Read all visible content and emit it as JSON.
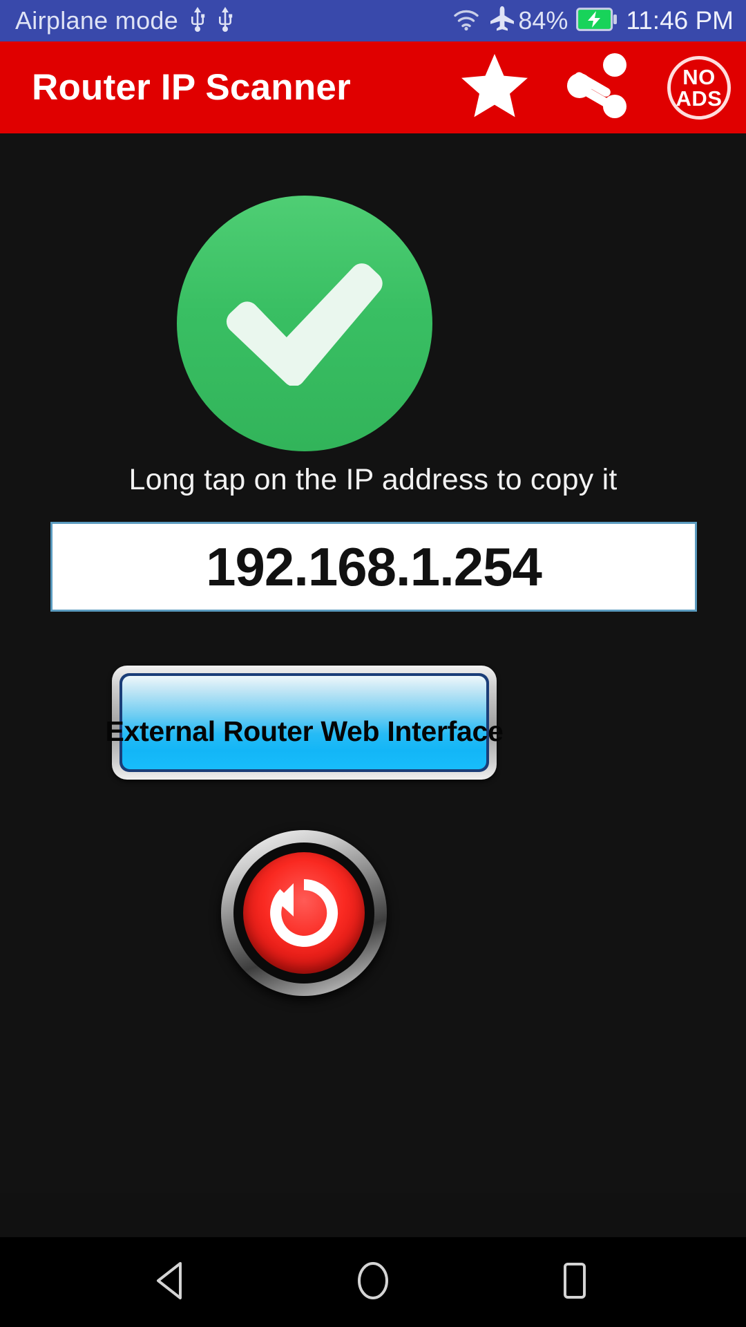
{
  "status_bar": {
    "airplane_label": "Airplane mode",
    "usb_icon_1": "usb-icon",
    "usb_icon_2": "usb-icon",
    "wifi_icon": "wifi-icon",
    "airplane_icon": "airplane-icon",
    "battery_percent": "84%",
    "battery_icon": "battery-charging-icon",
    "time": "11:46 PM",
    "background_color": "#3949ab"
  },
  "app_bar": {
    "title": "Router IP Scanner",
    "background_color": "#e00000",
    "actions": [
      {
        "name": "favorite-star-icon",
        "label": ""
      },
      {
        "name": "share-icon",
        "label": ""
      }
    ],
    "no_ads_badge": {
      "line1": "NO",
      "line2": "ADS"
    }
  },
  "main": {
    "status_icon": "success-check-icon",
    "status_color": "#3cc163",
    "hint": "Long tap on the IP address to copy it",
    "ip_address": "192.168.1.254",
    "ip_field_border_color": "#5b9bbf",
    "web_interface_button_label": "External Router Web Interface",
    "web_interface_button_color": "#18bdfb",
    "refresh_button_icon": "refresh-icon",
    "refresh_button_color": "#fa2a22"
  },
  "nav_bar": {
    "back": "back-triangle-icon",
    "home": "home-circle-icon",
    "recents": "recents-square-icon"
  }
}
